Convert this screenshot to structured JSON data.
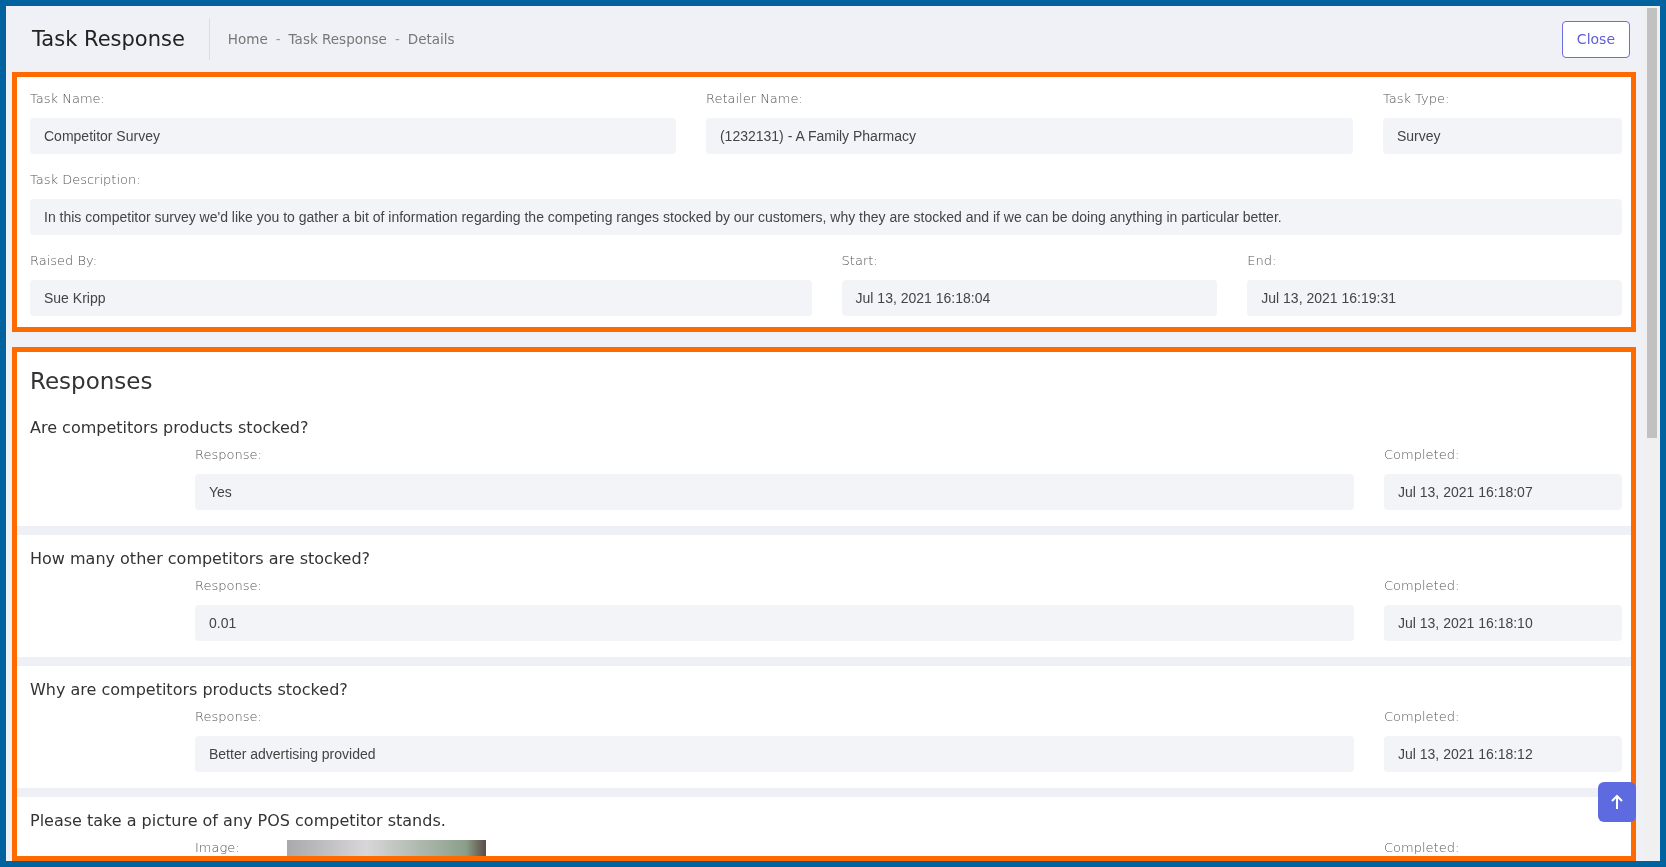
{
  "header": {
    "title": "Task Response",
    "breadcrumbs": [
      "Home",
      "Task Response",
      "Details"
    ],
    "separator": "-",
    "close_button": "Close"
  },
  "task": {
    "rows": [
      {
        "fields": [
          {
            "label": "Task Name:",
            "value": "Competitor Survey"
          },
          {
            "label": "Retailer Name:",
            "value": "(1232131) - A Family Pharmacy"
          },
          {
            "label": "Task Type:",
            "value": "Survey"
          }
        ]
      },
      {
        "fields": [
          {
            "label": "Task Description:",
            "value": "In this competitor survey we'd like you to gather a bit of information regarding the competing ranges stocked by our customers, why they are stocked and if we can be doing anything in particular better."
          }
        ]
      },
      {
        "fields": [
          {
            "label": "Raised By:",
            "value": "Sue Kripp"
          },
          {
            "label": "Start:",
            "value": "Jul 13, 2021 16:18:04"
          },
          {
            "label": "End:",
            "value": "Jul 13, 2021 16:19:31"
          }
        ]
      }
    ]
  },
  "responses": {
    "title": "Responses",
    "items": [
      {
        "kind": "text",
        "question": "Are competitors products stocked?",
        "label": "Response:",
        "value": "Yes",
        "completed_label": "Completed:",
        "completed": "Jul 13, 2021 16:18:07"
      },
      {
        "kind": "text",
        "question": "How many other competitors are stocked?",
        "label": "Response:",
        "value": "0.01",
        "completed_label": "Completed:",
        "completed": "Jul 13, 2021 16:18:10"
      },
      {
        "kind": "text",
        "question": "Why are competitors products stocked?",
        "label": "Response:",
        "value": "Better advertising provided",
        "completed_label": "Completed:",
        "completed": "Jul 13, 2021 16:18:12"
      },
      {
        "kind": "image",
        "question": "Please take a picture of any POS competitor stands.",
        "label": "Image:",
        "completed_label": "Completed:"
      }
    ]
  }
}
